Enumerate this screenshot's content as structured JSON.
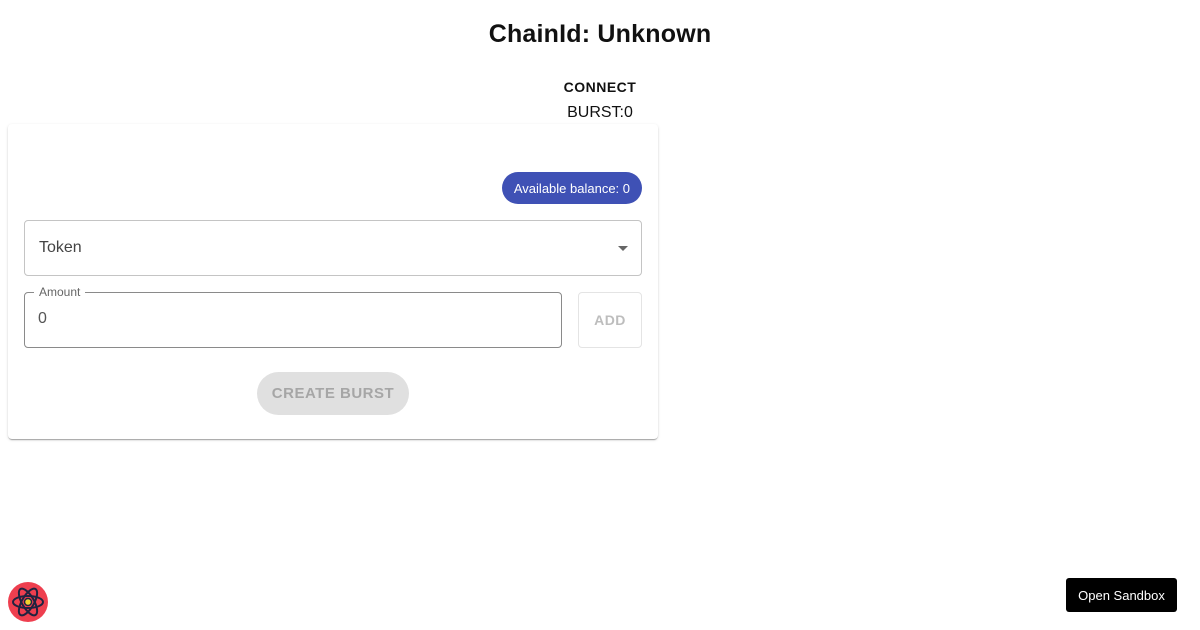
{
  "header": {
    "title": "ChainId: Unknown",
    "connect_label": "CONNECT",
    "burst_count": "BURST:0"
  },
  "form": {
    "balance_label": "Available balance: 0",
    "token_label": "Token",
    "amount_label": "Amount",
    "amount_value": "0",
    "add_label": "ADD",
    "create_label": "CREATE BURST"
  },
  "footer": {
    "sandbox_label": "Open Sandbox",
    "logo_icon": "react-atom-icon"
  },
  "colors": {
    "chip": "#3f51b5",
    "logo": "#ee3f4f"
  }
}
